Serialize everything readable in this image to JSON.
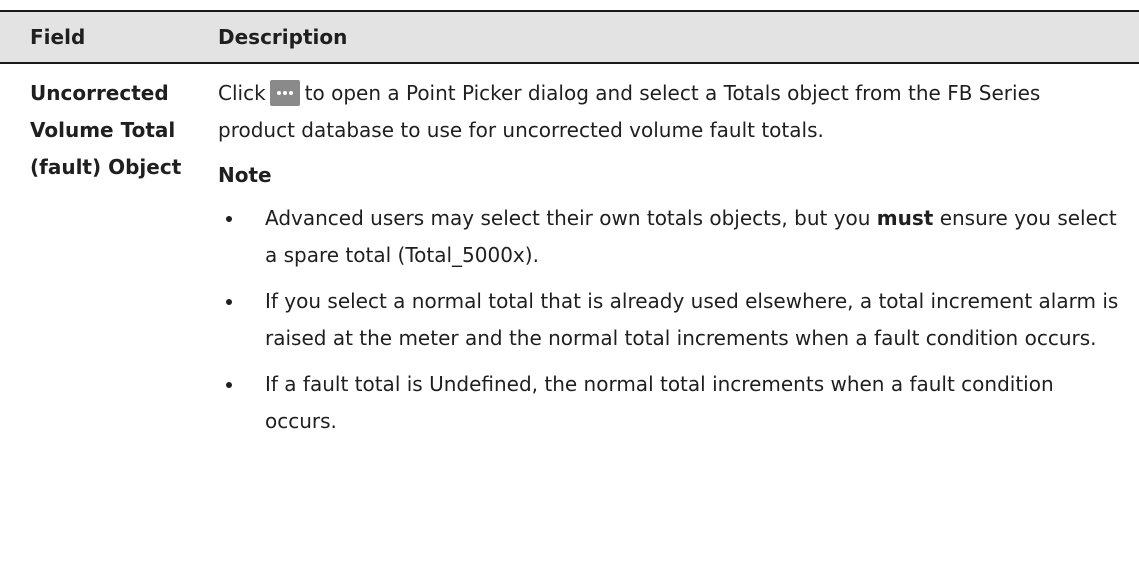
{
  "table": {
    "header": {
      "field": "Field",
      "description": "Description"
    },
    "row": {
      "field_line1": "Uncorrected",
      "field_line2": "Volume Total",
      "field_line3": "(fault) Object",
      "click": "Click",
      "picker_icon": "ellipsis-icon",
      "desc_rest": "to open a Point Picker dialog and select a Totals object from the FB Series product database to use for uncorrected volume fault totals.",
      "note_title": "Note",
      "notes": [
        {
          "text_before": "Advanced users may select their own totals objects, but you ",
          "emphasis": "must",
          "text_after": " ensure you select a spare total (Total_5000x)."
        },
        {
          "text": "If you select a normal total that is already used elsewhere, a total increment alarm is raised at the meter and the normal total increments when a fault condition occurs."
        },
        {
          "text": "If a fault total is Undefined, the normal total increments when a fault condition occurs."
        }
      ]
    }
  }
}
